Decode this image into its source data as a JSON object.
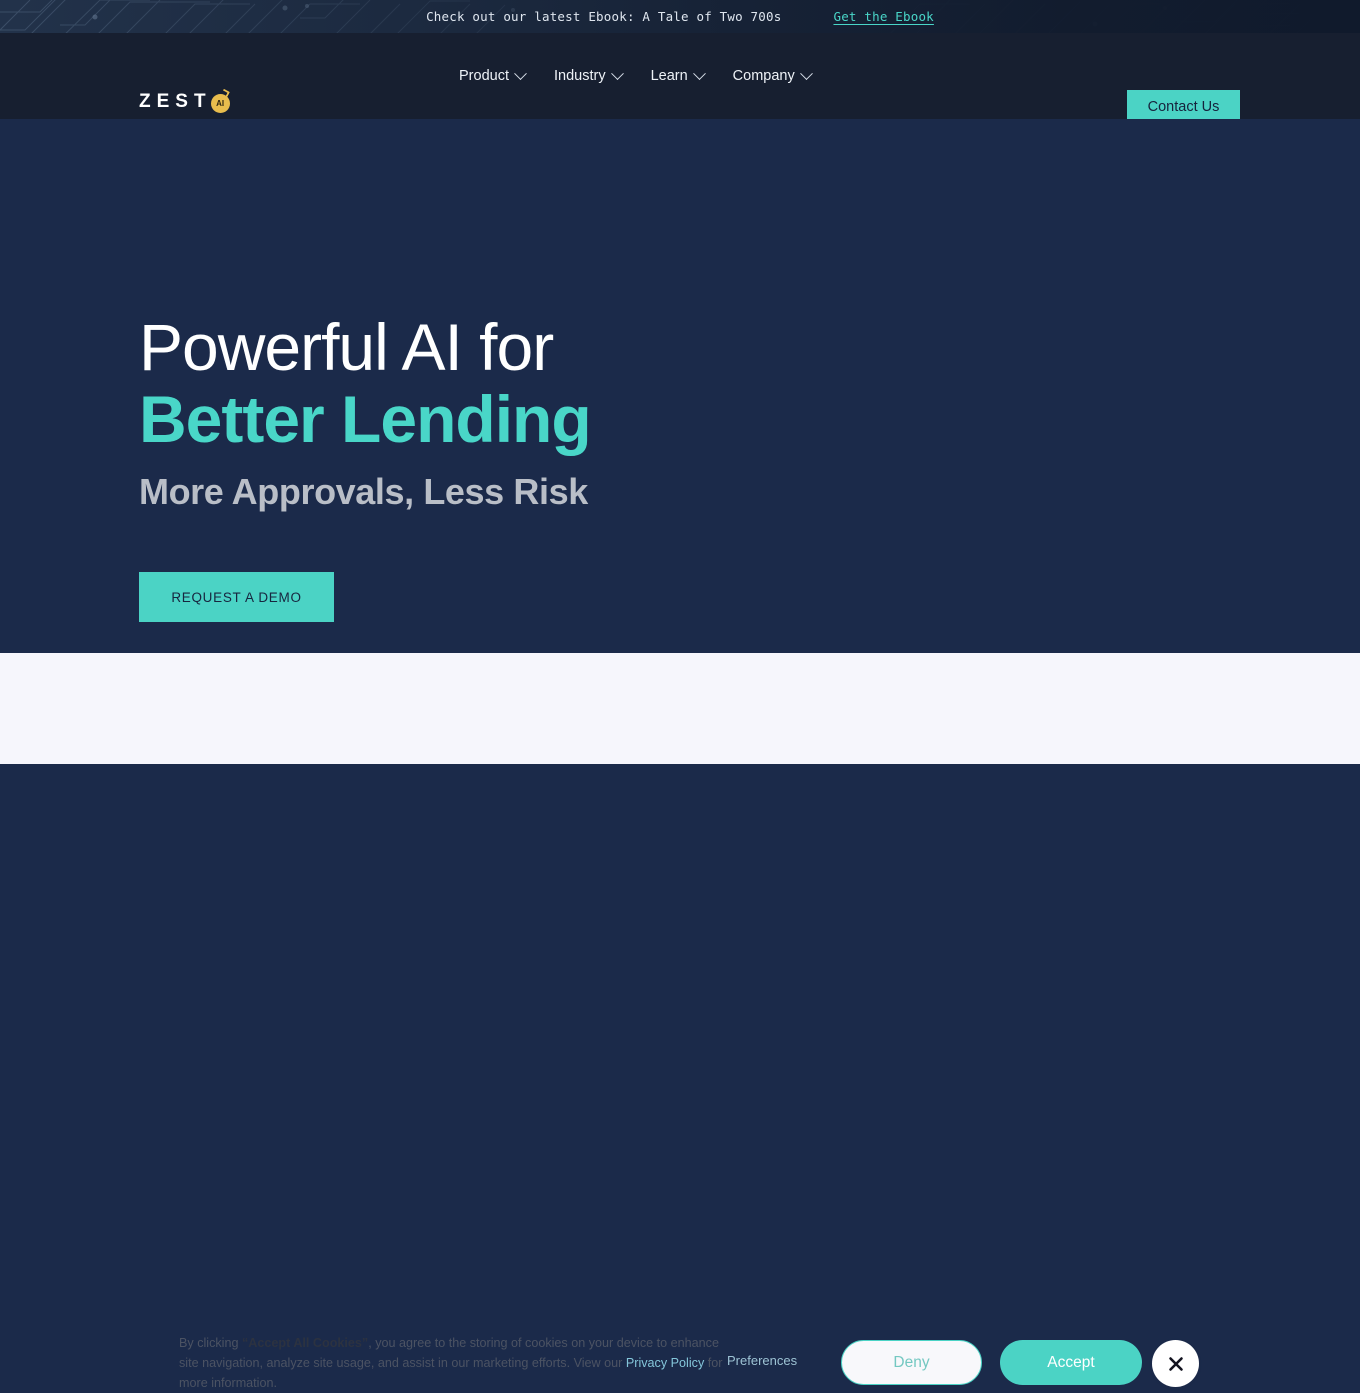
{
  "announcement": {
    "text": "Check out our latest Ebook: A Tale of Two 700s",
    "link_label": "Get the Ebook",
    "link_color": "#49d6c8",
    "background_color": "#22324a",
    "pattern": "circuit-board-lines"
  },
  "header": {
    "background_color": "#171f30",
    "logo": {
      "wordmark": "ZEST",
      "badge_text": "AI",
      "badge_color": "#e9bd4d"
    },
    "nav_items": [
      {
        "label": "Product",
        "icon": "chevron-down-icon"
      },
      {
        "label": "Industry",
        "icon": "chevron-down-icon"
      },
      {
        "label": "Learn",
        "icon": "chevron-down-icon"
      },
      {
        "label": "Company",
        "icon": "chevron-down-icon"
      }
    ],
    "contact_button": {
      "label": "Contact Us",
      "background_color": "#4bd3c5",
      "text_color": "#16233c"
    }
  },
  "hero": {
    "background_color": "#1b2a4a",
    "headline_line_1": "Powerful AI for",
    "headline_line_2": "Better Lending",
    "headline_line_2_color": "#49d6c8",
    "subheadline": "More Approvals, Less Risk",
    "subheadline_color": "#b9bec7",
    "cta_button": {
      "label": "REQUEST A DEMO",
      "background_color": "#4bd3c5",
      "text_color": "#17263f"
    }
  },
  "cookie_banner": {
    "background_color": "#f6f6fc",
    "text_prefix": "By clicking ",
    "text_bold": "“Accept All Cookies”",
    "text_middle": ", you agree to the storing of cookies on your device to enhance site navigation, analyze site usage, and assist in our marketing efforts. View our ",
    "privacy_link": "Privacy Policy",
    "text_suffix": " for more information.",
    "preferences_label": "Preferences",
    "deny_label": "Deny",
    "accept_label": "Accept",
    "close_icon": "close-icon",
    "accent_color": "#4bd3c5"
  }
}
